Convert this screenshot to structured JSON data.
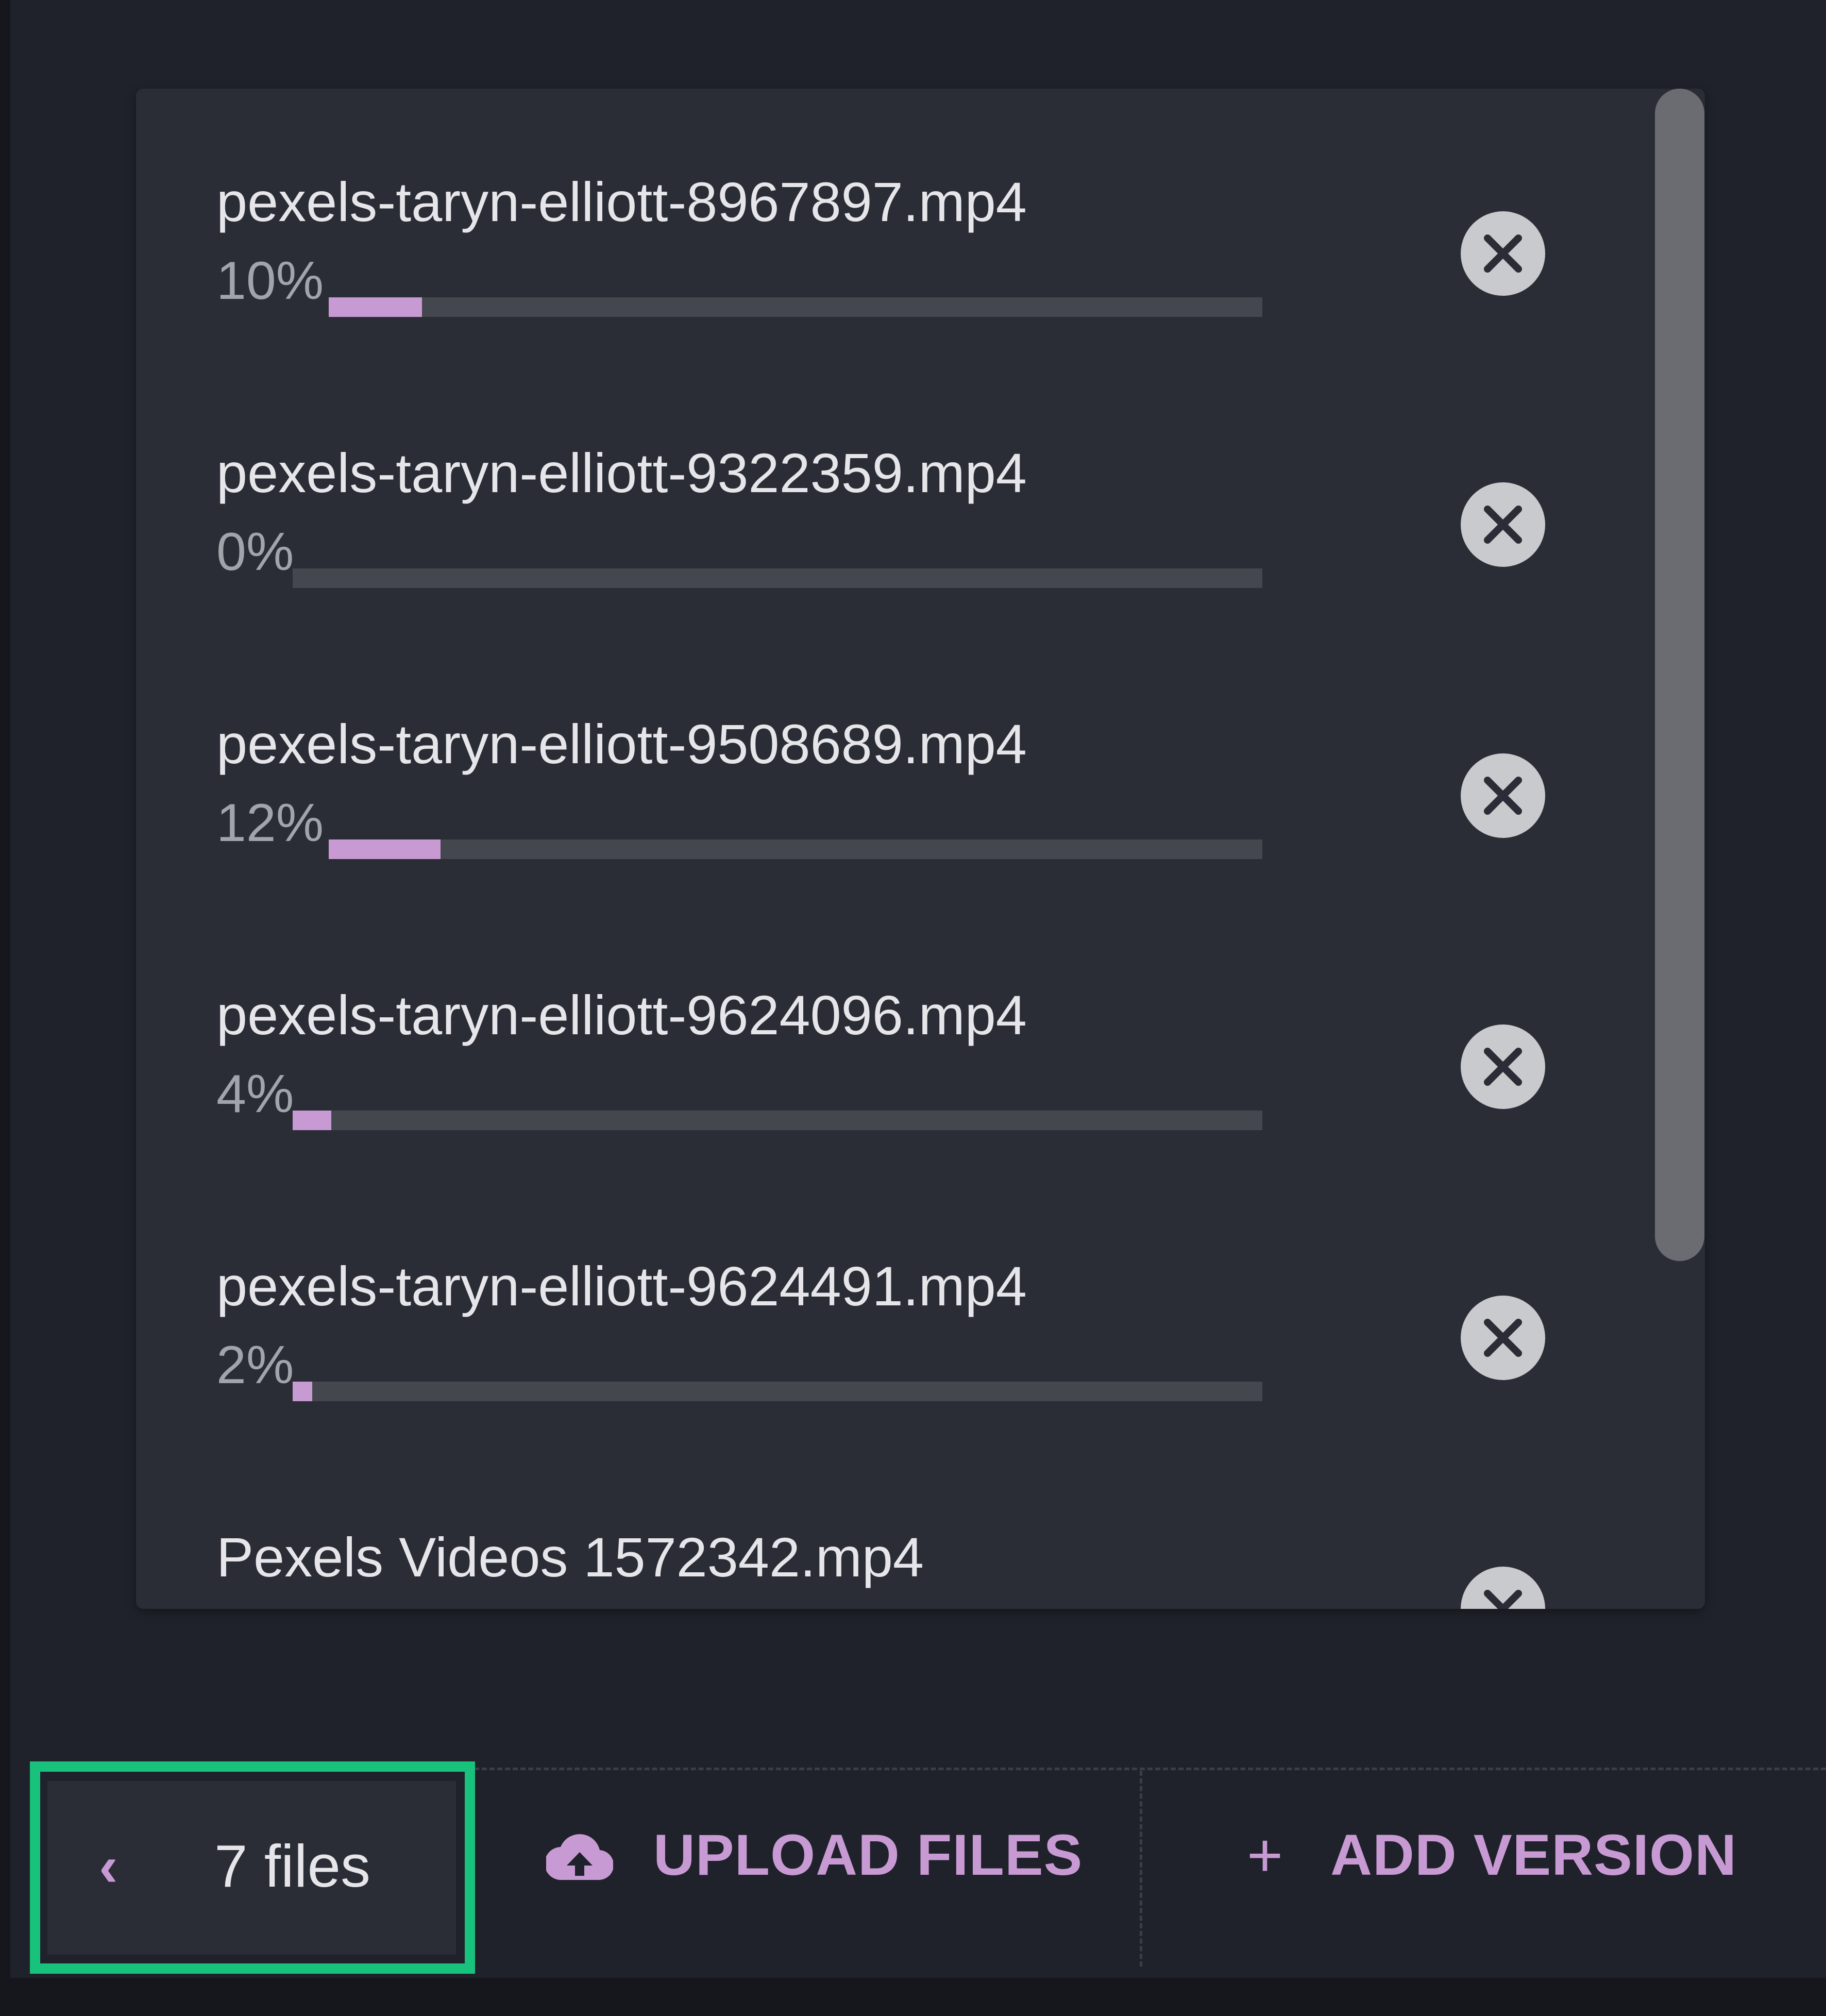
{
  "uploads": {
    "items": [
      {
        "file_name": "pexels-taryn-elliott-8967897.mp4",
        "progress_text": "10%",
        "progress": 0.1
      },
      {
        "file_name": "pexels-taryn-elliott-9322359.mp4",
        "progress_text": "0%",
        "progress": 0.0
      },
      {
        "file_name": "pexels-taryn-elliott-9508689.mp4",
        "progress_text": "12%",
        "progress": 0.12
      },
      {
        "file_name": "pexels-taryn-elliott-9624096.mp4",
        "progress_text": "4%",
        "progress": 0.04
      },
      {
        "file_name": "pexels-taryn-elliott-9624491.mp4",
        "progress_text": "2%",
        "progress": 0.02
      },
      {
        "file_name": "Pexels Videos 1572342.mp4",
        "progress_text": "",
        "progress": null
      }
    ],
    "cancel_icon": "close-circle-icon"
  },
  "footer": {
    "files_count_label": "7 files",
    "toggle_icon": "chevron-left-icon",
    "upload_label": "UPLOAD FILES",
    "upload_icon": "cloud-upload-icon",
    "add_version_label": "ADD VERSION",
    "add_icon": "plus-icon"
  },
  "colors": {
    "background": "#1f222a",
    "panel": "#2b2d36",
    "accent": "#c89ad3",
    "highlight": "#19c27c",
    "track": "#45474f"
  }
}
